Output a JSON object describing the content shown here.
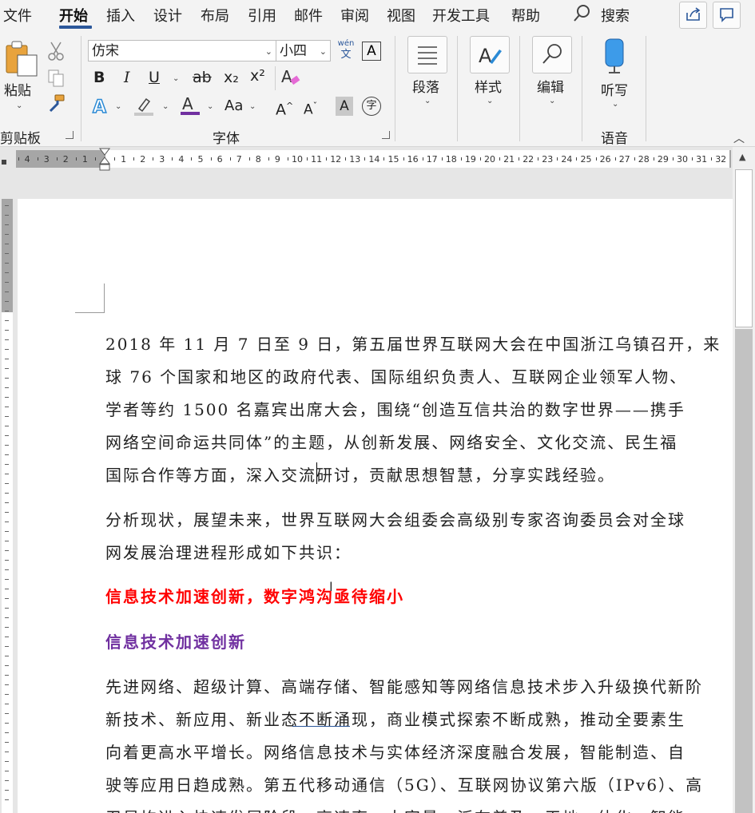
{
  "menu": {
    "tabs": [
      "文件",
      "开始",
      "插入",
      "设计",
      "布局",
      "引用",
      "邮件",
      "审阅",
      "视图",
      "开发工具",
      "帮助"
    ],
    "active_tab": "开始",
    "search_label": "搜索"
  },
  "ribbon": {
    "clipboard": {
      "paste_label": "粘贴",
      "group_label": "剪贴板"
    },
    "font": {
      "font_name": "仿宋",
      "font_size": "小四",
      "phonetic_top": "wén",
      "phonetic_bottom": "文",
      "bold": "B",
      "italic": "I",
      "underline": "U",
      "strike": "ab",
      "subscript": "x₂",
      "superscript": "x²",
      "case_label": "Aa",
      "grow": "A",
      "shrink": "A",
      "shade": "A",
      "enclose": "字",
      "group_label": "字体",
      "font_color_hex": "#7030a0",
      "highlight_color_hex": "#c8c8c8"
    },
    "paragraph_label": "段落",
    "styles_label": "样式",
    "editing_label": "编辑",
    "dictate_label": "听写",
    "voice_group_label": "语音"
  },
  "ruler": {
    "left_numbers": [
      "4",
      "3",
      "2",
      "1"
    ],
    "right_numbers": [
      "1",
      "2",
      "3",
      "4",
      "5",
      "6",
      "7",
      "8",
      "9",
      "10",
      "11",
      "12",
      "13",
      "14",
      "15",
      "16",
      "17",
      "18",
      "19",
      "20",
      "21",
      "22",
      "23",
      "24",
      "25",
      "26",
      "27",
      "28",
      "29",
      "30",
      "31",
      "32"
    ]
  },
  "document": {
    "paragraphs": [
      {
        "lines": [
          "2018 年 11 月 7 日至 9 日，第五届世界互联网大会在中国浙江乌镇召开，来",
          "球 76 个国家和地区的政府代表、国际组织负责人、互联网企业领军人物、",
          "学者等约 1500 名嘉宾出席大会，围绕“创造互信共治的数字世界——携手",
          "网络空间命运共同体”的主题，从创新发展、网络安全、文化交流、民生福",
          "国际合作等方面，深入交流研讨，贡献思想智慧，分享实践经验。"
        ]
      },
      {
        "lines": [
          "分析现状，展望未来，世界互联网大会组委会高级别专家咨询委员会对全球",
          "网发展治理进程形成如下共识："
        ]
      },
      {
        "heading1": "信息技术加速创新，数字鸿沟亟待缩小"
      },
      {
        "heading2": "信息技术加速创新"
      },
      {
        "lines": [
          "先进网络、超级计算、高端存储、智能感知等网络信息技术步入升级换代新阶",
          "新技术、新应用、新业态不断涌现，商业模式探索不断成熟，推动全要素生",
          "向着更高水平增长。网络信息技术与实体经济深度融合发展，智能制造、自",
          "驶等应用日趋成熟。第五代移动通信（5G）、互联网协议第六版（IPv6）、高",
          "卫星均进入快速发展阶段，高速率、大容量、泛在普及、天地一体化、智能"
        ]
      }
    ]
  }
}
